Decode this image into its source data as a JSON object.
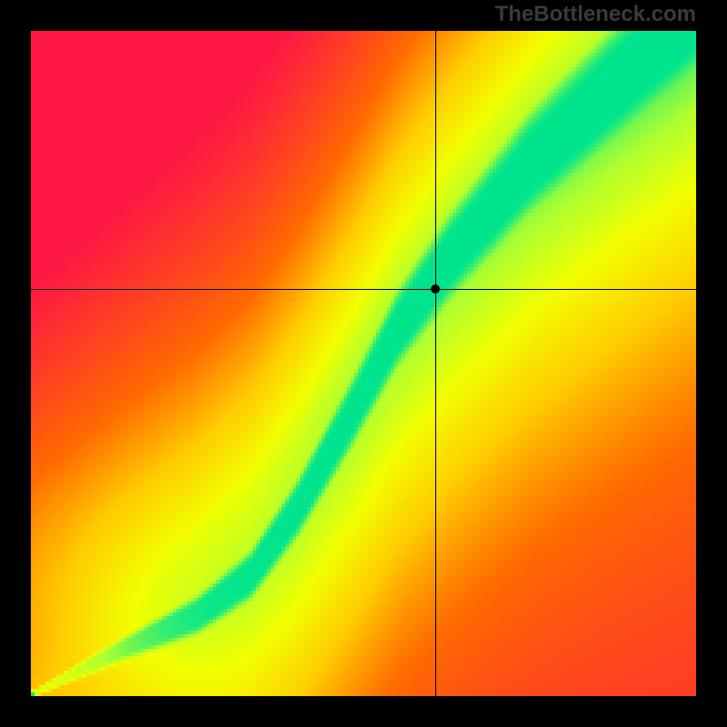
{
  "watermark": "TheBottleneck.com",
  "chart_data": {
    "type": "heatmap",
    "title": "",
    "xlabel": "",
    "ylabel": "",
    "xlim": [
      0,
      100
    ],
    "ylim": [
      0,
      100
    ],
    "crosshair": {
      "x": 60.8,
      "y": 61.2
    },
    "marker": {
      "x": 60.8,
      "y": 61.2
    },
    "colorscale": [
      {
        "t": 0.0,
        "color": "#ff1744"
      },
      {
        "t": 0.35,
        "color": "#ff6a00"
      },
      {
        "t": 0.55,
        "color": "#ffcc00"
      },
      {
        "t": 0.72,
        "color": "#f2ff00"
      },
      {
        "t": 0.85,
        "color": "#b0ff2e"
      },
      {
        "t": 1.0,
        "color": "#00e58d"
      }
    ],
    "ridge": [
      {
        "x": 0.0,
        "y": 0.0
      },
      {
        "x": 12.0,
        "y": 6.0
      },
      {
        "x": 25.0,
        "y": 12.0
      },
      {
        "x": 33.0,
        "y": 18.0
      },
      {
        "x": 40.0,
        "y": 28.0
      },
      {
        "x": 48.0,
        "y": 42.0
      },
      {
        "x": 55.0,
        "y": 55.0
      },
      {
        "x": 63.0,
        "y": 66.0
      },
      {
        "x": 75.0,
        "y": 80.0
      },
      {
        "x": 90.0,
        "y": 94.0
      },
      {
        "x": 100.0,
        "y": 103.0
      }
    ],
    "ridge_width": [
      {
        "x": 0.0,
        "w": 0.5
      },
      {
        "x": 20.0,
        "w": 2.5
      },
      {
        "x": 40.0,
        "w": 4.5
      },
      {
        "x": 60.0,
        "w": 6.5
      },
      {
        "x": 80.0,
        "w": 8.5
      },
      {
        "x": 100.0,
        "w": 10.0
      }
    ],
    "diagonal_strength": 0.9
  }
}
